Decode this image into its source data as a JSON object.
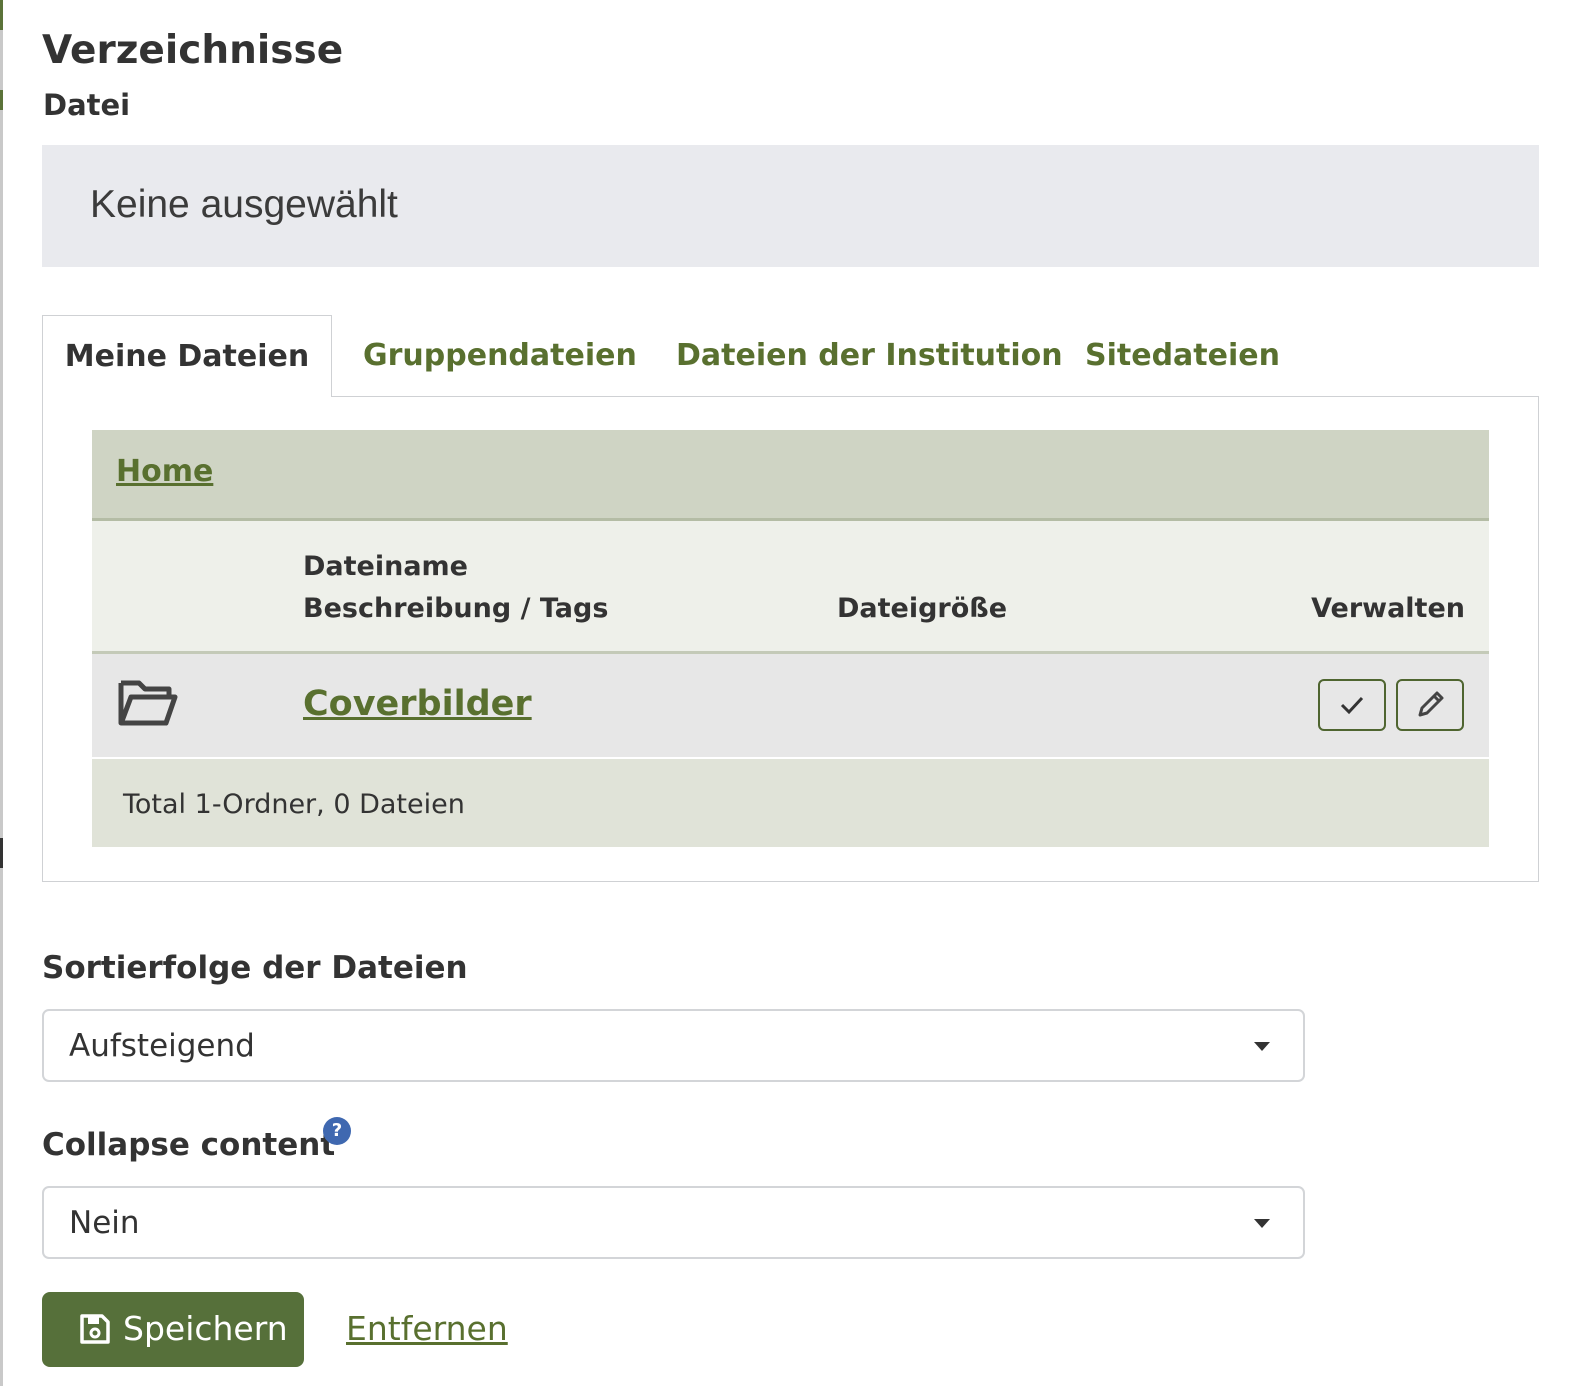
{
  "section": {
    "title": "Verzeichnisse",
    "subtitle": "Datei"
  },
  "selection": {
    "text": "Keine ausgewählt"
  },
  "tabs": [
    {
      "label": "Meine Dateien",
      "active": true
    },
    {
      "label": "Gruppendateien",
      "active": false
    },
    {
      "label": "Dateien der Institution",
      "active": false
    },
    {
      "label": "Sitedateien",
      "active": false
    }
  ],
  "breadcrumb": {
    "home": "Home"
  },
  "table": {
    "headers": {
      "name": "Dateiname",
      "description": "Beschreibung / Tags",
      "size": "Dateigröße",
      "manage": "Verwalten"
    },
    "rows": [
      {
        "icon": "folder-open-icon",
        "name": "Coverbilder",
        "actions": [
          "check-icon",
          "pencil-icon"
        ]
      }
    ],
    "footer": "Total 1-Ordner, 0 Dateien"
  },
  "sort": {
    "label": "Sortierfolge der Dateien",
    "value": "Aufsteigend"
  },
  "collapse": {
    "label": "Collapse content",
    "value": "Nein",
    "help": "?"
  },
  "actions": {
    "save": "Speichern",
    "remove": "Entfernen"
  },
  "colors": {
    "accent": "#59702f",
    "button": "#56703a",
    "help": "#3f68b0"
  }
}
